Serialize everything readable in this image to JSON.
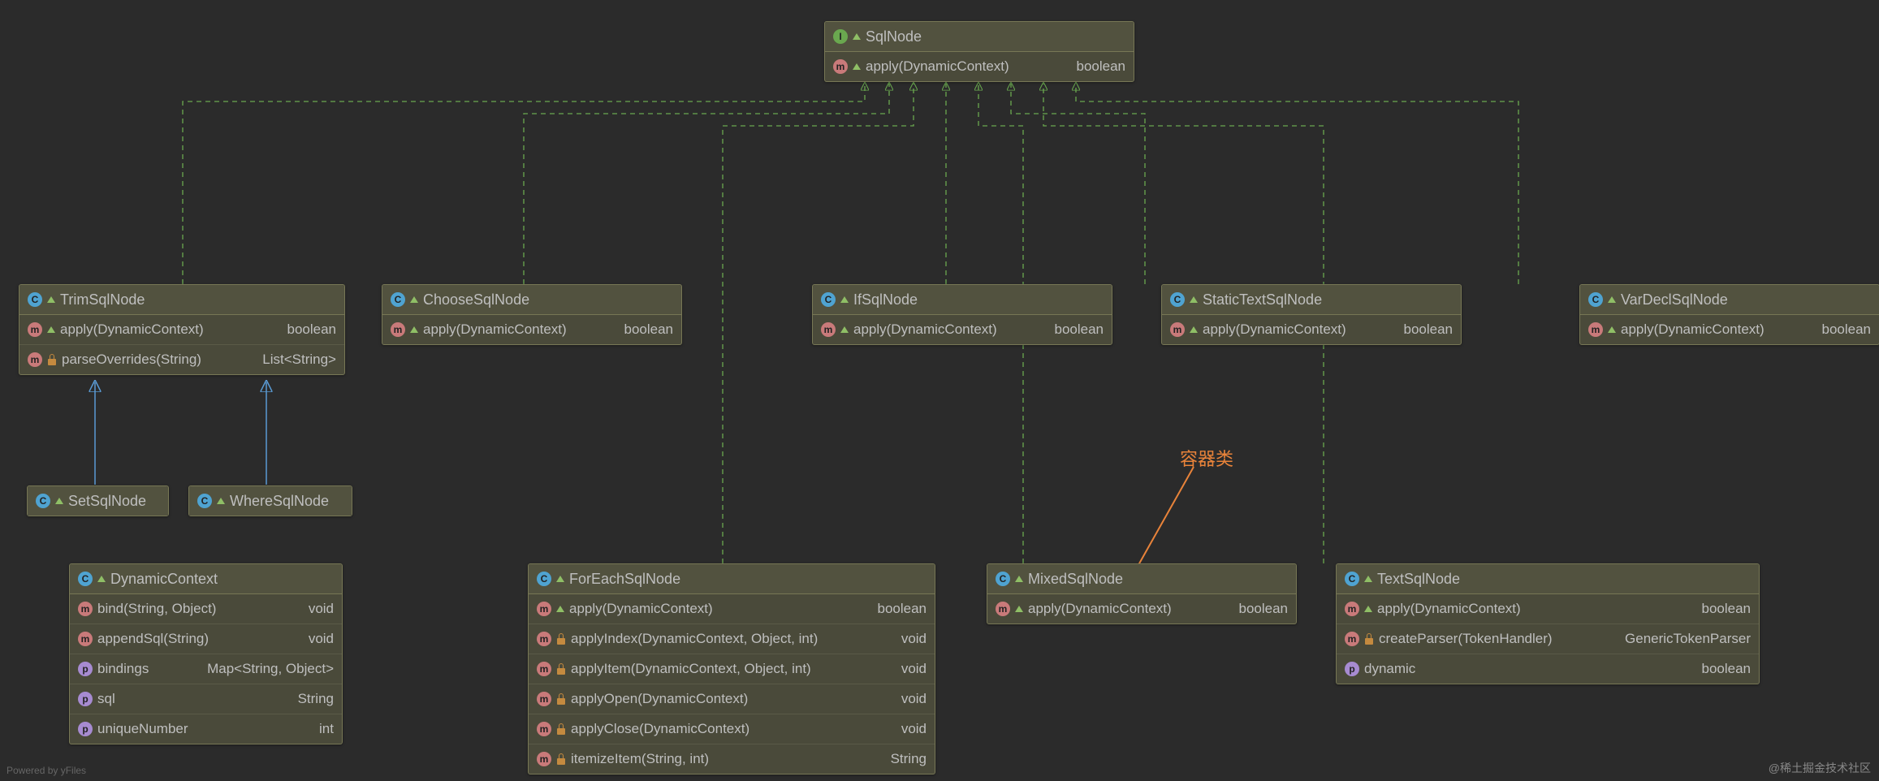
{
  "icons": {
    "interface": "I",
    "class": "C",
    "method": "m",
    "property": "p"
  },
  "nodes": {
    "sqlnode": {
      "title": "SqlNode",
      "members": [
        {
          "icon": "method",
          "arrow": true,
          "lock": false,
          "sig": "apply(DynamicContext)",
          "ret": "boolean"
        }
      ]
    },
    "trim": {
      "title": "TrimSqlNode",
      "members": [
        {
          "icon": "method",
          "arrow": true,
          "lock": false,
          "sig": "apply(DynamicContext)",
          "ret": "boolean"
        },
        {
          "icon": "method",
          "arrow": false,
          "lock": true,
          "sig": "parseOverrides(String)",
          "ret": "List<String>"
        }
      ]
    },
    "choose": {
      "title": "ChooseSqlNode",
      "members": [
        {
          "icon": "method",
          "arrow": true,
          "lock": false,
          "sig": "apply(DynamicContext)",
          "ret": "boolean"
        }
      ]
    },
    "ifnode": {
      "title": "IfSqlNode",
      "members": [
        {
          "icon": "method",
          "arrow": true,
          "lock": false,
          "sig": "apply(DynamicContext)",
          "ret": "boolean"
        }
      ]
    },
    "static": {
      "title": "StaticTextSqlNode",
      "members": [
        {
          "icon": "method",
          "arrow": true,
          "lock": false,
          "sig": "apply(DynamicContext)",
          "ret": "boolean"
        }
      ]
    },
    "vardecl": {
      "title": "VarDeclSqlNode",
      "members": [
        {
          "icon": "method",
          "arrow": true,
          "lock": false,
          "sig": "apply(DynamicContext)",
          "ret": "boolean"
        }
      ]
    },
    "set": {
      "title": "SetSqlNode"
    },
    "where": {
      "title": "WhereSqlNode"
    },
    "dyn": {
      "title": "DynamicContext",
      "members": [
        {
          "icon": "method",
          "arrow": false,
          "lock": false,
          "sig": "bind(String, Object)",
          "ret": "void"
        },
        {
          "icon": "method",
          "arrow": false,
          "lock": false,
          "sig": "appendSql(String)",
          "ret": "void"
        },
        {
          "icon": "property",
          "arrow": false,
          "lock": false,
          "sig": "bindings",
          "ret": "Map<String, Object>"
        },
        {
          "icon": "property",
          "arrow": false,
          "lock": false,
          "sig": "sql",
          "ret": "String"
        },
        {
          "icon": "property",
          "arrow": false,
          "lock": false,
          "sig": "uniqueNumber",
          "ret": "int"
        }
      ]
    },
    "foreach": {
      "title": "ForEachSqlNode",
      "members": [
        {
          "icon": "method",
          "arrow": true,
          "lock": false,
          "sig": "apply(DynamicContext)",
          "ret": "boolean"
        },
        {
          "icon": "method",
          "arrow": false,
          "lock": true,
          "sig": "applyIndex(DynamicContext, Object, int)",
          "ret": "void"
        },
        {
          "icon": "method",
          "arrow": false,
          "lock": true,
          "sig": "applyItem(DynamicContext, Object, int)",
          "ret": "void"
        },
        {
          "icon": "method",
          "arrow": false,
          "lock": true,
          "sig": "applyOpen(DynamicContext)",
          "ret": "void"
        },
        {
          "icon": "method",
          "arrow": false,
          "lock": true,
          "sig": "applyClose(DynamicContext)",
          "ret": "void"
        },
        {
          "icon": "method",
          "arrow": false,
          "lock": true,
          "sig": "itemizeItem(String, int)",
          "ret": "String"
        }
      ]
    },
    "mixed": {
      "title": "MixedSqlNode",
      "members": [
        {
          "icon": "method",
          "arrow": true,
          "lock": false,
          "sig": "apply(DynamicContext)",
          "ret": "boolean"
        }
      ]
    },
    "text": {
      "title": "TextSqlNode",
      "members": [
        {
          "icon": "method",
          "arrow": true,
          "lock": false,
          "sig": "apply(DynamicContext)",
          "ret": "boolean"
        },
        {
          "icon": "method",
          "arrow": false,
          "lock": true,
          "sig": "createParser(TokenHandler)",
          "ret": "GenericTokenParser"
        },
        {
          "icon": "property",
          "arrow": false,
          "lock": false,
          "sig": "dynamic",
          "ret": "boolean"
        }
      ]
    }
  },
  "annotation": "容器类",
  "watermark": "@稀土掘金技术社区",
  "powered": "Powered by yFiles"
}
